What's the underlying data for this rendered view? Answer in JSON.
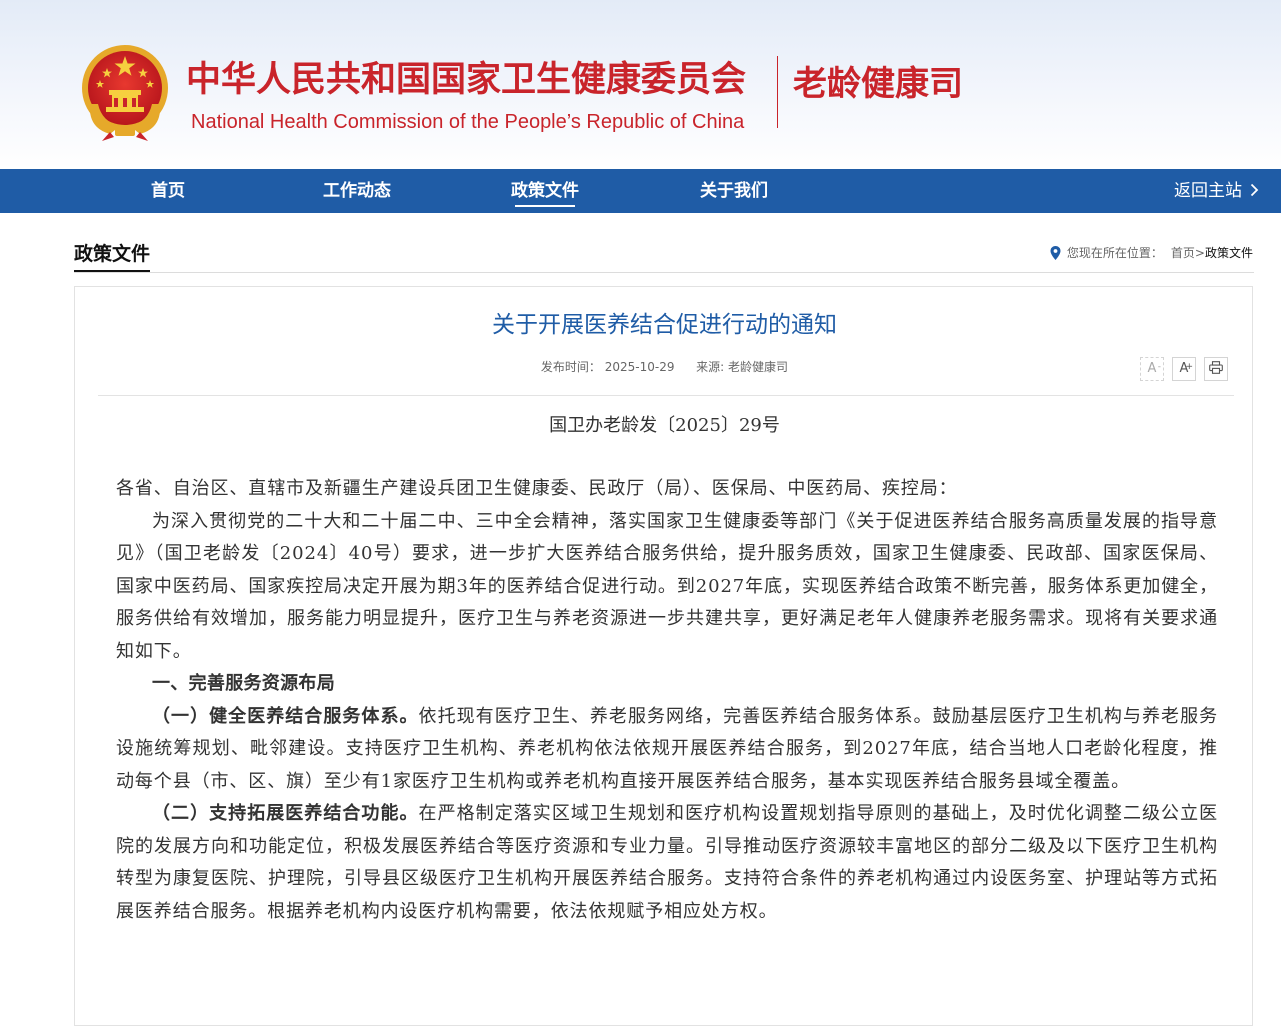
{
  "header": {
    "org_name_cn": "中华人民共和国国家卫生健康委员会",
    "org_name_en": "National Health Commission of the People’s Republic of China",
    "dept_name": "老龄健康司",
    "emblem_icon": "national-emblem-icon",
    "title_color": "#c9242b"
  },
  "nav": {
    "bg_color": "#1f5ca6",
    "items": [
      {
        "label": "首页",
        "active": false
      },
      {
        "label": "工作动态",
        "active": false
      },
      {
        "label": "政策文件",
        "active": true
      },
      {
        "label": "关于我们",
        "active": false
      }
    ],
    "back_label": "返回主站",
    "back_icon": "chevron-right-icon"
  },
  "section": {
    "title": "政策文件"
  },
  "breadcrumb": {
    "prefix": "您现在所在位置：",
    "home": "首页",
    "separator": ">",
    "current": "政策文件",
    "icon": "location-pin-icon"
  },
  "article": {
    "title": "关于开展医养结合促进行动的通知",
    "title_color": "#1f5ca6",
    "publish_label": "发布时间：",
    "publish_date": "2025-10-29",
    "source_label": "来源:",
    "source": "老龄健康司",
    "tools": {
      "font_decrease": "A",
      "font_increase": "A",
      "print_icon": "printer-icon"
    },
    "doc_number": "国卫办老龄发〔2025〕29号",
    "salutation": "各省、自治区、直辖市及新疆生产建设兵团卫生健康委、民政厅（局）、医保局、中医药局、疾控局：",
    "intro": "为深入贯彻党的二十大和二十届二中、三中全会精神，落实国家卫生健康委等部门《关于促进医养结合服务高质量发展的指导意见》（国卫老龄发〔2024〕40号）要求，进一步扩大医养结合服务供给，提升服务质效，国家卫生健康委、民政部、国家医保局、国家中医药局、国家疾控局决定开展为期3年的医养结合促进行动。到2027年底，实现医养结合政策不断完善，服务体系更加健全，服务供给有效增加，服务能力明显提升，医疗卫生与养老资源进一步共建共享，更好满足老年人健康养老服务需求。现将有关要求通知如下。",
    "section1_heading": "一、完善服务资源布局",
    "item1_title": "（一）健全医养结合服务体系。",
    "item1_text": "依托现有医疗卫生、养老服务网络，完善医养结合服务体系。鼓励基层医疗卫生机构与养老服务设施统筹规划、毗邻建设。支持医疗卫生机构、养老机构依法依规开展医养结合服务，到2027年底，结合当地人口老龄化程度，推动每个县（市、区、旗）至少有1家医疗卫生机构或养老机构直接开展医养结合服务，基本实现医养结合服务县域全覆盖。",
    "item2_title": "（二）支持拓展医养结合功能。",
    "item2_text": "在严格制定落实区域卫生规划和医疗机构设置规划指导原则的基础上，及时优化调整二级公立医院的发展方向和功能定位，积极发展医养结合等医疗资源和专业力量。引导推动医疗资源较丰富地区的部分二级及以下医疗卫生机构转型为康复医院、护理院，引导县区级医疗卫生机构开展医养结合服务。支持符合条件的养老机构通过内设医务室、护理站等方式拓展医养结合服务。根据养老机构内设医疗机构需要，依法依规赋予相应处方权。"
  }
}
